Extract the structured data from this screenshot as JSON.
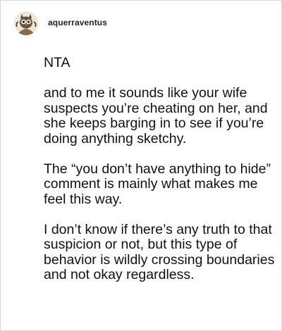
{
  "post": {
    "username": "aquerraventus",
    "paragraphs": [
      "NTA",
      "and to me it sounds like your wife suspects you’re cheating on her, and she keeps barging in to see if you’re doing anything sketchy.",
      "The “you don’t have anything to hide” comment is mainly what makes me feel this way.",
      "I don’t know if there’s any truth to that suspicion or not, but this type of behavior is wildly crossing boundaries and not okay regardless."
    ]
  },
  "icons": {
    "avatar": "owl-avatar-icon"
  }
}
